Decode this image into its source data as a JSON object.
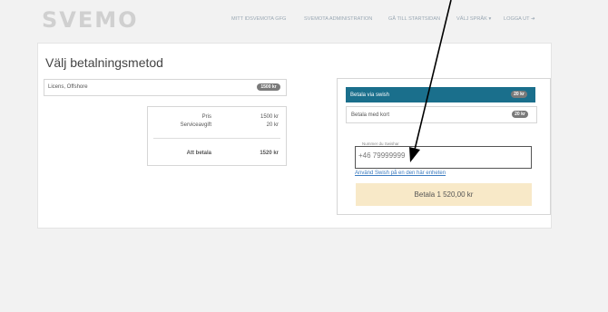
{
  "header": {
    "logo": "SVEMO",
    "nav": [
      {
        "label": "MITT IDSVEMOTA gfg"
      },
      {
        "label": "SVEMOTA ADMINISTRATION"
      },
      {
        "label": "GÅ TILL STARTSIDAN"
      },
      {
        "label": "VÄLJ SPRÅK ▾"
      },
      {
        "label": "LOGGA UT ➜"
      }
    ]
  },
  "page": {
    "title": "Välj betalningsmetod"
  },
  "order": {
    "item_label": "Licens, Offshore",
    "item_badge": "1500 kr",
    "summary": {
      "price_label": "Pris",
      "price_value": "1500 kr",
      "fee_label": "Serviceavgift",
      "fee_value": "20 kr",
      "total_label": "Att betala",
      "total_value": "1520 kr"
    }
  },
  "payment": {
    "methods": [
      {
        "label": "Betala via swish",
        "badge": "20 kr"
      },
      {
        "label": "Betala med kort",
        "badge": "20 kr"
      }
    ],
    "phone_legend": "Nummer du Swishar",
    "phone_value": "+46 79999999",
    "swish_link": "Använd Swish på en den här enheten",
    "pay_button": "Betala 1 520,00 kr"
  },
  "colors": {
    "accent": "#1a6f8c",
    "pay_button_bg": "#f8e9c8",
    "badge_bg": "#7a7a7a",
    "link": "#3b7bbf"
  }
}
